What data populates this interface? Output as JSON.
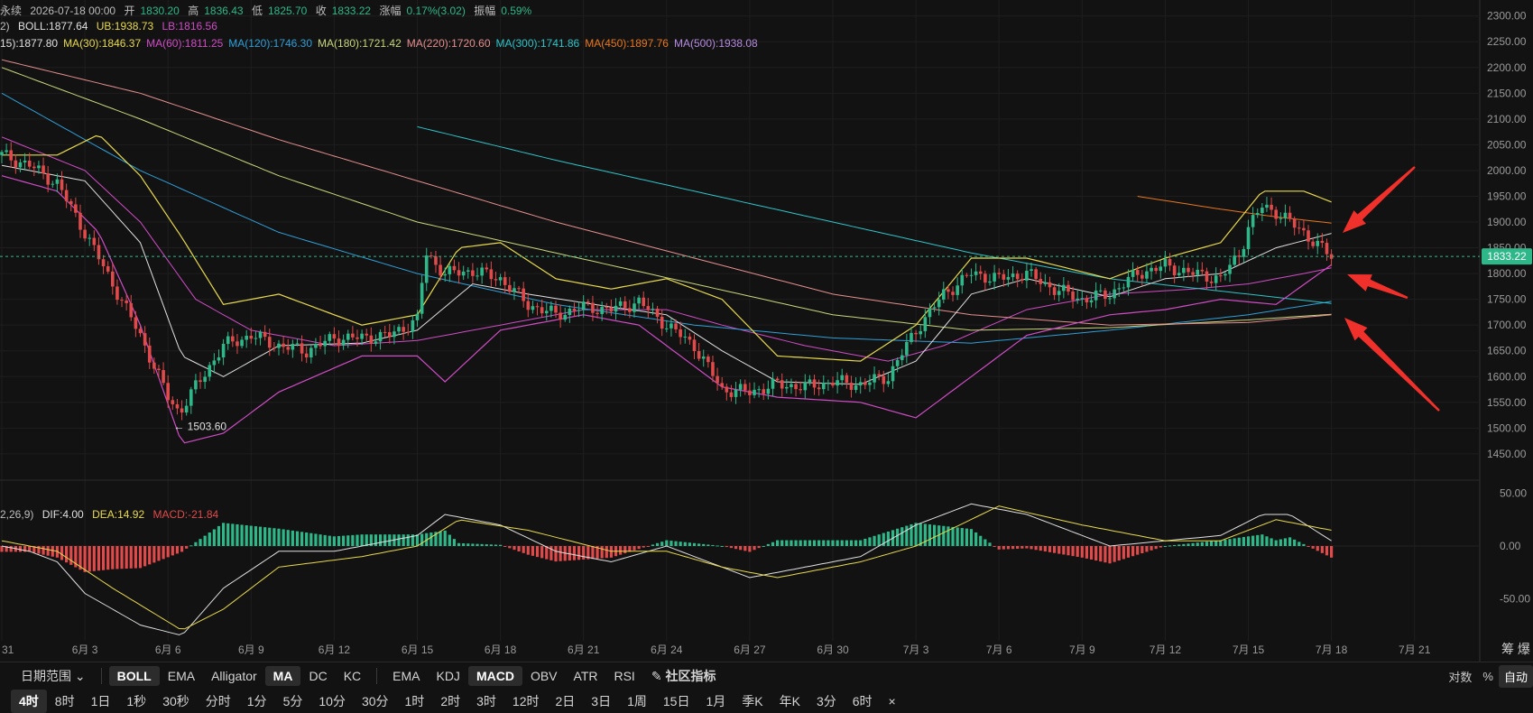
{
  "header": {
    "symbol_fragment": "永续",
    "datetime": "2026-07-18 00:00",
    "open_label": "开",
    "open": "1830.20",
    "high_label": "高",
    "high": "1836.43",
    "low_label": "低",
    "low": "1825.70",
    "close_label": "收",
    "close": "1833.22",
    "change_label": "涨幅",
    "change": "0.17%(3.02)",
    "amp_label": "振幅",
    "amp": "0.59%"
  },
  "boll": {
    "prefix": "2)",
    "mid": "BOLL:1877.64",
    "ub": "UB:1938.73",
    "lb": "LB:1816.56"
  },
  "ma": {
    "items": [
      {
        "text": "15):1877.80",
        "color": "#e0e0e0"
      },
      {
        "text": "MA(30):1846.37",
        "color": "#e8d94a"
      },
      {
        "text": "MA(60):1811.25",
        "color": "#d04cc6"
      },
      {
        "text": "MA(120):1746.30",
        "color": "#2e9fd8"
      },
      {
        "text": "MA(180):1721.42",
        "color": "#c9d67a"
      },
      {
        "text": "MA(220):1720.60",
        "color": "#e58e8e"
      },
      {
        "text": "MA(300):1741.86",
        "color": "#2ec3c9"
      },
      {
        "text": "MA(450):1897.76",
        "color": "#e8771c"
      },
      {
        "text": "MA(500):1938.08",
        "color": "#b58ae0"
      }
    ]
  },
  "macd": {
    "prefix": "2,26,9)",
    "dif": "DIF:4.00",
    "dea": "DEA:14.92",
    "macd": "MACD:-21.84"
  },
  "colors": {
    "up": "#2eb88a",
    "down": "#e04a4a",
    "boll_mid": "#e0e0e0",
    "boll_band": "#e8d94a",
    "price_tag": "#2eb88a"
  },
  "indicators": {
    "date_range": "日期范围",
    "items": [
      "BOLL",
      "EMA",
      "Alligator",
      "MA",
      "DC",
      "KC"
    ],
    "active": [
      "BOLL",
      "MA"
    ],
    "sub_items": [
      "EMA",
      "KDJ",
      "MACD",
      "OBV",
      "ATR",
      "RSI"
    ],
    "sub_active": "MACD",
    "community": "社区指标"
  },
  "right_controls": {
    "log": "对数",
    "pct": "%",
    "auto": "自动"
  },
  "timeframes": {
    "items": [
      "4时",
      "8时",
      "1日",
      "1秒",
      "30秒",
      "分时",
      "1分",
      "5分",
      "10分",
      "30分",
      "1时",
      "2时",
      "3时",
      "12时",
      "2日",
      "3日",
      "1周",
      "15日",
      "1月",
      "季K",
      "年K",
      "3分",
      "6时"
    ],
    "active": "4时",
    "close": "×"
  },
  "axis_right_corner": "筹 爆",
  "low_annotation": "← 1503.60",
  "last_price": "1833.22",
  "chart_data": {
    "type": "candlestick",
    "price_axis": {
      "ticks": [
        2300,
        2250,
        2200,
        2150,
        2100,
        2050,
        2000,
        1950,
        1900,
        1850,
        1800,
        1750,
        1700,
        1650,
        1600,
        1550,
        1500,
        1450
      ],
      "labels": [
        "2300.00",
        "2250.00",
        "2200.00",
        "2150.00",
        "2100.00",
        "2050.00",
        "2000.00",
        "1950.00",
        "1900.00",
        "1850.00",
        "1800.00",
        "1750.00",
        "1700.00",
        "1650.00",
        "1600.00",
        "1550.00",
        "1500.00",
        "1450.00"
      ],
      "ylim": [
        1420,
        2310
      ]
    },
    "macd_axis": {
      "ticks": [
        50,
        0,
        -50
      ],
      "labels": [
        "50.00",
        "0.00",
        "-50.00"
      ],
      "ylim": [
        -90,
        60
      ]
    },
    "time_axis": {
      "labels": [
        "31",
        "6月 3",
        "6月 6",
        "6月 9",
        "6月 12",
        "6月 15",
        "6月 18",
        "6月 21",
        "6月 24",
        "6月 27",
        "6月 30",
        "7月 3",
        "7月 6",
        "7月 9",
        "7月 12",
        "7月 15",
        "7月 18",
        "7月 21"
      ],
      "day_index": [
        0,
        3,
        6,
        9,
        12,
        15,
        18,
        21,
        24,
        27,
        30,
        33,
        36,
        39,
        42,
        45,
        48,
        51
      ]
    },
    "close_path": [
      [
        0,
        2030
      ],
      [
        1,
        2010
      ],
      [
        2,
        1975
      ],
      [
        3,
        1880
      ],
      [
        4,
        1780
      ],
      [
        5,
        1680
      ],
      [
        6,
        1560
      ],
      [
        6.4,
        1530
      ],
      [
        7,
        1580
      ],
      [
        8,
        1660
      ],
      [
        9,
        1680
      ],
      [
        10,
        1660
      ],
      [
        11,
        1650
      ],
      [
        12,
        1675
      ],
      [
        13,
        1675
      ],
      [
        14,
        1680
      ],
      [
        15,
        1710
      ],
      [
        15.3,
        1840
      ],
      [
        16,
        1800
      ],
      [
        17,
        1805
      ],
      [
        18,
        1790
      ],
      [
        19,
        1740
      ],
      [
        20,
        1720
      ],
      [
        21,
        1735
      ],
      [
        22,
        1730
      ],
      [
        23,
        1745
      ],
      [
        24,
        1700
      ],
      [
        25,
        1660
      ],
      [
        26,
        1575
      ],
      [
        27,
        1570
      ],
      [
        28,
        1585
      ],
      [
        29,
        1580
      ],
      [
        30,
        1590
      ],
      [
        31,
        1585
      ],
      [
        32,
        1600
      ],
      [
        33,
        1690
      ],
      [
        34,
        1760
      ],
      [
        35,
        1800
      ],
      [
        36,
        1790
      ],
      [
        37,
        1800
      ],
      [
        38,
        1770
      ],
      [
        39,
        1750
      ],
      [
        40,
        1760
      ],
      [
        41,
        1800
      ],
      [
        42,
        1815
      ],
      [
        43,
        1800
      ],
      [
        44,
        1790
      ],
      [
        44.7,
        1840
      ],
      [
        45,
        1890
      ],
      [
        45.5,
        1930
      ],
      [
        46,
        1920
      ],
      [
        47,
        1880
      ],
      [
        47.5,
        1855
      ],
      [
        48,
        1833
      ]
    ],
    "boll": {
      "mid": [
        [
          0,
          2010
        ],
        [
          1,
          2000
        ],
        [
          3,
          1980
        ],
        [
          5,
          1860
        ],
        [
          6.5,
          1640
        ],
        [
          8,
          1600
        ],
        [
          10,
          1660
        ],
        [
          13,
          1665
        ],
        [
          15,
          1690
        ],
        [
          17,
          1780
        ],
        [
          19,
          1760
        ],
        [
          22,
          1735
        ],
        [
          24,
          1720
        ],
        [
          26,
          1650
        ],
        [
          28,
          1590
        ],
        [
          31,
          1585
        ],
        [
          33,
          1630
        ],
        [
          35,
          1760
        ],
        [
          37,
          1790
        ],
        [
          40,
          1755
        ],
        [
          42,
          1790
        ],
        [
          44,
          1800
        ],
        [
          46,
          1850
        ],
        [
          48,
          1878
        ]
      ],
      "ub": [
        [
          0,
          2030
        ],
        [
          2,
          2030
        ],
        [
          3.5,
          2070
        ],
        [
          5,
          1990
        ],
        [
          6.5,
          1870
        ],
        [
          8,
          1740
        ],
        [
          10,
          1760
        ],
        [
          13,
          1700
        ],
        [
          15,
          1720
        ],
        [
          16.5,
          1850
        ],
        [
          18,
          1860
        ],
        [
          20,
          1790
        ],
        [
          22,
          1770
        ],
        [
          24,
          1790
        ],
        [
          26,
          1750
        ],
        [
          28,
          1640
        ],
        [
          31,
          1630
        ],
        [
          33,
          1700
        ],
        [
          35,
          1830
        ],
        [
          37,
          1830
        ],
        [
          40,
          1790
        ],
        [
          42,
          1830
        ],
        [
          44,
          1860
        ],
        [
          45.5,
          1960
        ],
        [
          47,
          1960
        ],
        [
          48,
          1939
        ]
      ],
      "lb": [
        [
          0,
          1990
        ],
        [
          2,
          1960
        ],
        [
          3.5,
          1880
        ],
        [
          5,
          1700
        ],
        [
          6.5,
          1470
        ],
        [
          8,
          1490
        ],
        [
          10,
          1570
        ],
        [
          13,
          1640
        ],
        [
          15,
          1640
        ],
        [
          16,
          1590
        ],
        [
          18,
          1690
        ],
        [
          21,
          1720
        ],
        [
          23,
          1700
        ],
        [
          26,
          1580
        ],
        [
          28,
          1560
        ],
        [
          31,
          1550
        ],
        [
          33,
          1520
        ],
        [
          35,
          1600
        ],
        [
          37,
          1680
        ],
        [
          40,
          1720
        ],
        [
          42,
          1730
        ],
        [
          44,
          1750
        ],
        [
          46,
          1740
        ],
        [
          48,
          1817
        ]
      ]
    },
    "ma_lines": [
      {
        "name": "MA(60)",
        "color": "#d04cc6",
        "points": [
          [
            0,
            2065
          ],
          [
            3,
            2000
          ],
          [
            5,
            1900
          ],
          [
            7,
            1750
          ],
          [
            9,
            1690
          ],
          [
            12,
            1660
          ],
          [
            15,
            1670
          ],
          [
            18,
            1700
          ],
          [
            21,
            1730
          ],
          [
            24,
            1730
          ],
          [
            26,
            1700
          ],
          [
            29,
            1660
          ],
          [
            32,
            1630
          ],
          [
            34,
            1660
          ],
          [
            37,
            1730
          ],
          [
            40,
            1760
          ],
          [
            43,
            1770
          ],
          [
            45,
            1780
          ],
          [
            47,
            1800
          ],
          [
            48,
            1811
          ]
        ]
      },
      {
        "name": "MA(120)",
        "color": "#2e9fd8",
        "points": [
          [
            0,
            2150
          ],
          [
            5,
            2000
          ],
          [
            10,
            1880
          ],
          [
            15,
            1800
          ],
          [
            20,
            1740
          ],
          [
            25,
            1700
          ],
          [
            30,
            1675
          ],
          [
            35,
            1665
          ],
          [
            40,
            1690
          ],
          [
            45,
            1720
          ],
          [
            48,
            1746
          ]
        ]
      },
      {
        "name": "MA(180)",
        "color": "#c9d67a",
        "points": [
          [
            0,
            2200
          ],
          [
            5,
            2100
          ],
          [
            10,
            1990
          ],
          [
            15,
            1900
          ],
          [
            20,
            1840
          ],
          [
            25,
            1780
          ],
          [
            30,
            1720
          ],
          [
            35,
            1690
          ],
          [
            40,
            1695
          ],
          [
            45,
            1710
          ],
          [
            48,
            1721
          ]
        ]
      },
      {
        "name": "MA(220)",
        "color": "#e58e8e",
        "points": [
          [
            0,
            2215
          ],
          [
            5,
            2150
          ],
          [
            10,
            2060
          ],
          [
            15,
            1980
          ],
          [
            20,
            1900
          ],
          [
            25,
            1830
          ],
          [
            30,
            1760
          ],
          [
            35,
            1720
          ],
          [
            40,
            1700
          ],
          [
            45,
            1705
          ],
          [
            48,
            1720
          ]
        ]
      },
      {
        "name": "MA(300)",
        "color": "#2ec3c9",
        "points": [
          [
            15,
            2085
          ],
          [
            20,
            2020
          ],
          [
            25,
            1960
          ],
          [
            30,
            1900
          ],
          [
            35,
            1840
          ],
          [
            40,
            1790
          ],
          [
            45,
            1760
          ],
          [
            48,
            1742
          ]
        ]
      },
      {
        "name": "MA(450)",
        "color": "#e8771c",
        "points": [
          [
            41,
            1950
          ],
          [
            44,
            1925
          ],
          [
            46,
            1910
          ],
          [
            48,
            1898
          ]
        ]
      }
    ],
    "macd_series": {
      "dif": [
        [
          0,
          0
        ],
        [
          1,
          -5
        ],
        [
          2,
          -15
        ],
        [
          3,
          -45
        ],
        [
          5,
          -75
        ],
        [
          6.5,
          -85
        ],
        [
          8,
          -40
        ],
        [
          10,
          -5
        ],
        [
          12,
          -5
        ],
        [
          15,
          10
        ],
        [
          16,
          30
        ],
        [
          18,
          20
        ],
        [
          20,
          -5
        ],
        [
          22,
          -15
        ],
        [
          24,
          0
        ],
        [
          25,
          -10
        ],
        [
          27,
          -30
        ],
        [
          29,
          -20
        ],
        [
          31,
          -10
        ],
        [
          33,
          20
        ],
        [
          35,
          40
        ],
        [
          37,
          30
        ],
        [
          40,
          0
        ],
        [
          42,
          5
        ],
        [
          44,
          10
        ],
        [
          45.5,
          30
        ],
        [
          46.5,
          30
        ],
        [
          48,
          5
        ]
      ],
      "dea": [
        [
          0,
          5
        ],
        [
          2,
          -5
        ],
        [
          4,
          -40
        ],
        [
          6.5,
          -80
        ],
        [
          8,
          -60
        ],
        [
          10,
          -20
        ],
        [
          13,
          -10
        ],
        [
          15,
          0
        ],
        [
          16.5,
          25
        ],
        [
          19,
          15
        ],
        [
          22,
          -5
        ],
        [
          24,
          -5
        ],
        [
          26,
          -20
        ],
        [
          28,
          -30
        ],
        [
          31,
          -15
        ],
        [
          33,
          0
        ],
        [
          36,
          38
        ],
        [
          39,
          20
        ],
        [
          42,
          5
        ],
        [
          44,
          5
        ],
        [
          46,
          25
        ],
        [
          47,
          20
        ],
        [
          48,
          15
        ]
      ],
      "hist_note": "histogram is derived as DIF minus DEA"
    },
    "annotations": {
      "low": 1503.6,
      "arrows": 3
    }
  }
}
